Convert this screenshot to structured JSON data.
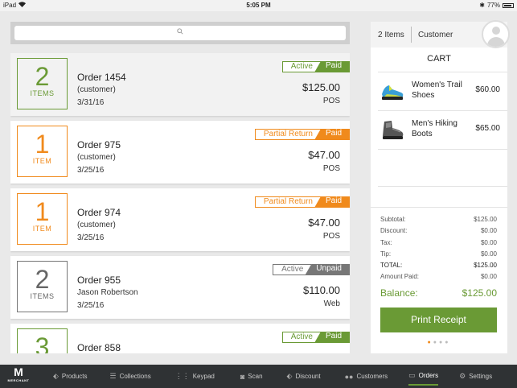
{
  "status_bar": {
    "device": "iPad",
    "time": "5:05 PM",
    "battery": "77%"
  },
  "search": {
    "placeholder": ""
  },
  "orders": [
    {
      "count": "2",
      "unit": "ITEMS",
      "title": "Order 1454",
      "customer": "(customer)",
      "date": "3/31/16",
      "amount": "$125.00",
      "channel": "POS",
      "status_left": "Active",
      "status_right": "Paid",
      "color": "#6a9a35",
      "selected": true
    },
    {
      "count": "1",
      "unit": "ITEM",
      "title": "Order 975",
      "customer": "(customer)",
      "date": "3/25/16",
      "amount": "$47.00",
      "channel": "POS",
      "status_left": "Partial Return",
      "status_right": "Paid",
      "color": "#f08a1c"
    },
    {
      "count": "1",
      "unit": "ITEM",
      "title": "Order 974",
      "customer": "(customer)",
      "date": "3/25/16",
      "amount": "$47.00",
      "channel": "POS",
      "status_left": "Partial Return",
      "status_right": "Paid",
      "color": "#f08a1c"
    },
    {
      "count": "2",
      "unit": "ITEMS",
      "title": "Order 955",
      "customer": "Jason Robertson",
      "date": "3/25/16",
      "amount": "$110.00",
      "channel": "Web",
      "status_left": "Active",
      "status_right": "Unpaid",
      "color": "#777777"
    },
    {
      "count": "3",
      "unit": "",
      "title": "Order 858",
      "customer": "",
      "date": "",
      "amount": "",
      "channel": "",
      "status_left": "Active",
      "status_right": "Paid",
      "color": "#6a9a35"
    }
  ],
  "cart": {
    "items_count": "2 Items",
    "customer_label": "Customer",
    "title": "CART",
    "items": [
      {
        "name": "Women's Trail Shoes",
        "price": "$60.00",
        "icon": "trail-shoe-icon"
      },
      {
        "name": "Men's Hiking Boots",
        "price": "$65.00",
        "icon": "hiking-boot-icon"
      }
    ],
    "totals": [
      {
        "label": "Subtotal:",
        "value": "$125.00"
      },
      {
        "label": "Discount:",
        "value": "$0.00"
      },
      {
        "label": "Tax:",
        "value": "$0.00"
      },
      {
        "label": "Tip:",
        "value": "$0.00"
      },
      {
        "label": "TOTAL:",
        "value": "$125.00"
      },
      {
        "label": "Amount Paid:",
        "value": "$0.00"
      }
    ],
    "balance_label": "Balance:",
    "balance_value": "$125.00",
    "print_label": "Print Receipt"
  },
  "nav": {
    "logo": "M",
    "logo_sub": "MERCHANT",
    "items": [
      {
        "label": "Products",
        "icon": "tag-icon"
      },
      {
        "label": "Collections",
        "icon": "list-icon"
      },
      {
        "label": "Keypad",
        "icon": "keypad-icon"
      },
      {
        "label": "Scan",
        "icon": "camera-icon"
      },
      {
        "label": "Discount",
        "icon": "discount-tag-icon"
      },
      {
        "label": "Customers",
        "icon": "people-icon"
      },
      {
        "label": "Orders",
        "icon": "monitor-icon",
        "active": true
      },
      {
        "label": "Settings",
        "icon": "gear-icon"
      }
    ]
  },
  "colors": {
    "green": "#6a9a35",
    "orange": "#f08a1c",
    "gray": "#777777",
    "nav_bg": "#2f3234"
  }
}
